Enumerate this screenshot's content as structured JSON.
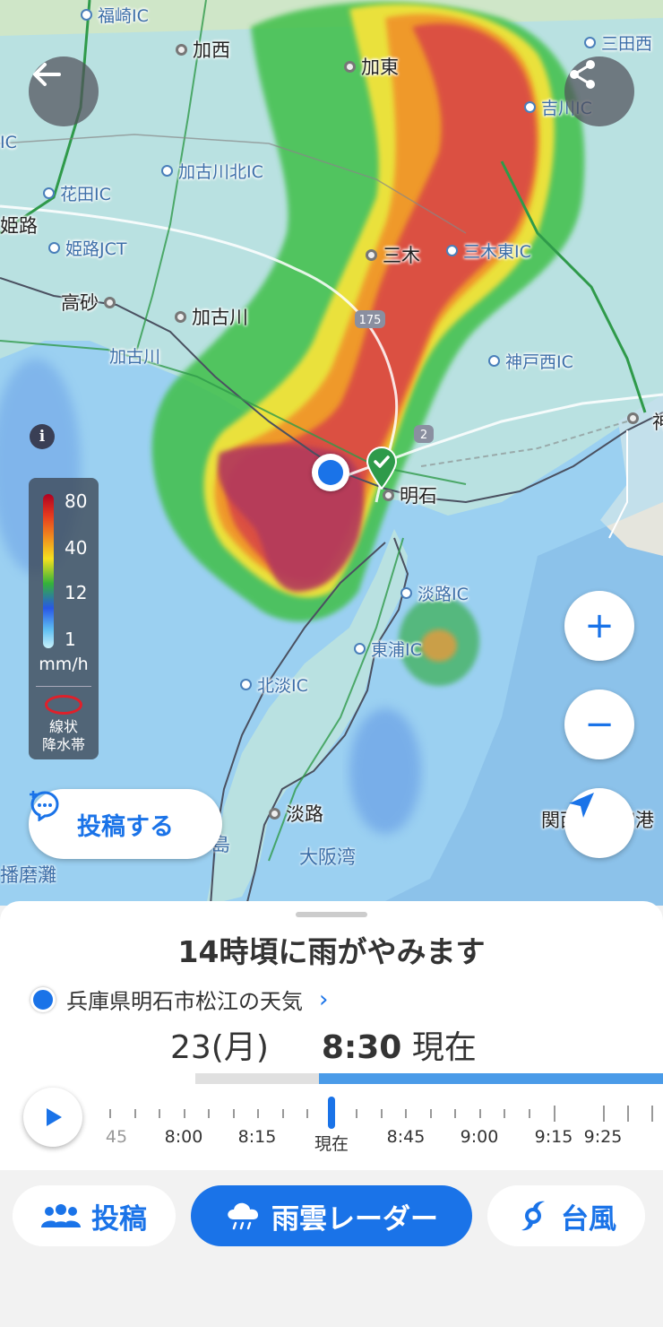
{
  "map": {
    "places": [
      {
        "name": "福崎IC",
        "type": "ic"
      },
      {
        "name": "加西",
        "type": "city"
      },
      {
        "name": "加東",
        "type": "city"
      },
      {
        "name": "三田西",
        "type": "ic"
      },
      {
        "name": "吉川IC",
        "type": "ic"
      },
      {
        "name": "加古川北IC",
        "type": "ic"
      },
      {
        "name": "花田IC",
        "type": "ic"
      },
      {
        "name": "姫路",
        "type": "city"
      },
      {
        "name": "姫路JCT",
        "type": "ic"
      },
      {
        "name": "三木",
        "type": "city"
      },
      {
        "name": "三木東IC",
        "type": "ic"
      },
      {
        "name": "高砂",
        "type": "city"
      },
      {
        "name": "加古川",
        "type": "city"
      },
      {
        "name": "加古川",
        "type": "ic"
      },
      {
        "name": "神戸西IC",
        "type": "ic"
      },
      {
        "name": "明石",
        "type": "city"
      },
      {
        "name": "淡路IC",
        "type": "ic"
      },
      {
        "name": "東浦IC",
        "type": "ic"
      },
      {
        "name": "北淡IC",
        "type": "ic"
      },
      {
        "name": "淡路",
        "type": "city"
      },
      {
        "name": "関西国際空港",
        "type": "city"
      }
    ],
    "water_labels": [
      "大阪湾",
      "播磨灘"
    ],
    "route_badges": [
      "175",
      "2"
    ],
    "island_fragment": "島",
    "edge_fragments": [
      "IC",
      "神"
    ]
  },
  "legend": {
    "ticks": [
      "80",
      "40",
      "12",
      "1"
    ],
    "unit": "mm/h",
    "band_label_1": "線状",
    "band_label_2": "降水帯",
    "colors": [
      "#b00021",
      "#e63a1e",
      "#f5e11e",
      "#34b23a",
      "#2857e6",
      "#c9f2fb"
    ]
  },
  "buttons": {
    "back_icon": "back-arrow-icon",
    "share_icon": "share-icon",
    "post": "投稿する",
    "zoom_in": "+",
    "zoom_out": "−"
  },
  "sheet": {
    "headline": "14時頃に雨がやみます",
    "location": "兵庫県明石市松江の天気",
    "date": "23(月)",
    "time": "8:30",
    "now_suffix": "現在",
    "timeline_labels": [
      "45",
      "8:00",
      "8:15",
      "現在",
      "8:45",
      "9:00",
      "9:15",
      "9:25"
    ],
    "accent": "#1a73e8"
  },
  "tabs": [
    {
      "label": "投稿",
      "icon": "people-icon",
      "active": false
    },
    {
      "label": "雨雲レーダー",
      "icon": "rain-cloud-icon",
      "active": true
    },
    {
      "label": "台風",
      "icon": "typhoon-icon",
      "active": false
    }
  ]
}
